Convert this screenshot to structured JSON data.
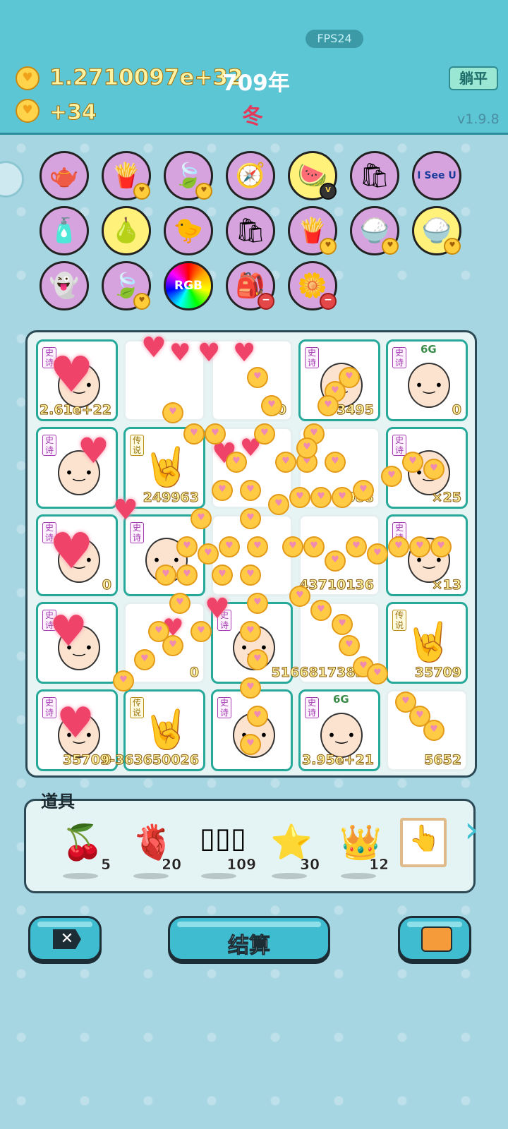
{
  "header": {
    "fps": "FPS24",
    "money": "1.2710097e+32",
    "year": "709年",
    "income": "+34",
    "season": "冬",
    "lie_flat_button": "躺平",
    "version": "v1.9.8"
  },
  "items": {
    "row1": [
      "gravy-boat",
      "fries",
      "leaf",
      "compass",
      "fruit-basket",
      "shop-card",
      "i-see-u"
    ],
    "row2": [
      "pump-bottle",
      "pomelo",
      "chick",
      "shop-card",
      "fries",
      "rice-bowl",
      "rice-bowl"
    ],
    "row3": [
      "ghost",
      "leaf",
      "rgb-ball",
      "sack",
      "potted-flower"
    ],
    "i_see_u_text": "I See U",
    "rgb_text": "RGB"
  },
  "board": {
    "cells": [
      {
        "tag": "史诗",
        "label": "2.61e+22"
      },
      {
        "tag": "",
        "label": ""
      },
      {
        "tag": "",
        "label": "0"
      },
      {
        "tag": "史诗",
        "label": "3495"
      },
      {
        "tag": "史诗",
        "label": "0",
        "badge": "6G"
      },
      {
        "tag": "史诗",
        "label": ""
      },
      {
        "tag": "传说",
        "label": "249963"
      },
      {
        "tag": "",
        "label": ""
      },
      {
        "tag": "",
        "label": "6088"
      },
      {
        "tag": "史诗",
        "label": "×25"
      },
      {
        "tag": "史诗",
        "label": "0"
      },
      {
        "tag": "史诗",
        "label": ""
      },
      {
        "tag": "",
        "label": ""
      },
      {
        "tag": "",
        "label": "43710136"
      },
      {
        "tag": "史诗",
        "label": "×13"
      },
      {
        "tag": "史诗",
        "label": ""
      },
      {
        "tag": "",
        "label": "0"
      },
      {
        "tag": "史诗",
        "label": ""
      },
      {
        "tag": "",
        "label": "51668173825"
      },
      {
        "tag": "传说",
        "label": "35709"
      },
      {
        "tag": "史诗",
        "label": "0"
      },
      {
        "tag": "传说",
        "label": "35709-363650026"
      },
      {
        "tag": "史诗",
        "label": ""
      },
      {
        "tag": "史诗",
        "label": "3.95e+21",
        "badge": "6G"
      },
      {
        "tag": "",
        "label": "5652"
      }
    ]
  },
  "tools": {
    "title": "道具",
    "items": [
      {
        "name": "lychee",
        "count": "5"
      },
      {
        "name": "liver",
        "count": "20"
      },
      {
        "name": "battery-pack",
        "count": "109"
      },
      {
        "name": "star",
        "count": "30"
      },
      {
        "name": "crown",
        "count": "12"
      },
      {
        "name": "pointer-card",
        "count": ""
      }
    ]
  },
  "bottom": {
    "settle_label": "结算"
  }
}
